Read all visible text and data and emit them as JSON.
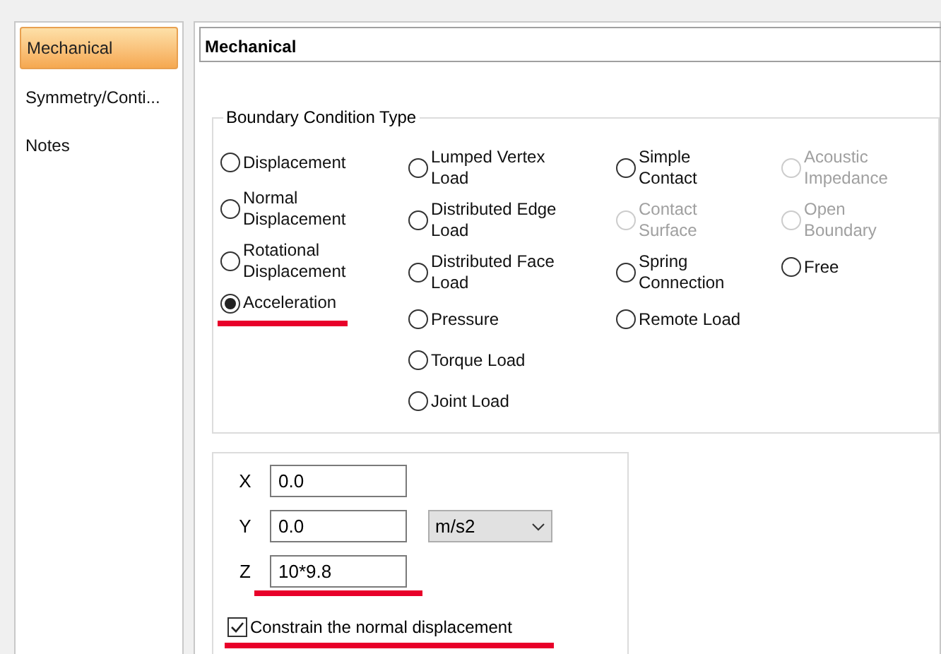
{
  "sidebar": {
    "items": [
      {
        "label": "Mechanical",
        "selected": true
      },
      {
        "label": "Symmetry/Conti...",
        "selected": false
      },
      {
        "label": "Notes",
        "selected": false
      }
    ]
  },
  "panel": {
    "title": "Mechanical"
  },
  "boundary_condition_type": {
    "title": "Boundary Condition Type",
    "columns": [
      [
        {
          "label": "Displacement",
          "selected": false,
          "disabled": false,
          "underlined": false
        },
        {
          "label": "Normal\nDisplacement",
          "selected": false,
          "disabled": false,
          "underlined": false
        },
        {
          "label": "Rotational\nDisplacement",
          "selected": false,
          "disabled": false,
          "underlined": false
        },
        {
          "label": "Acceleration",
          "selected": true,
          "disabled": false,
          "underlined": true
        }
      ],
      [
        {
          "label": "Lumped Vertex\nLoad",
          "selected": false,
          "disabled": false,
          "underlined": false
        },
        {
          "label": "Distributed Edge\nLoad",
          "selected": false,
          "disabled": false,
          "underlined": false
        },
        {
          "label": "Distributed Face\nLoad",
          "selected": false,
          "disabled": false,
          "underlined": false
        },
        {
          "label": "Pressure",
          "selected": false,
          "disabled": false,
          "underlined": false
        },
        {
          "label": "Torque Load",
          "selected": false,
          "disabled": false,
          "underlined": false
        },
        {
          "label": "Joint Load",
          "selected": false,
          "disabled": false,
          "underlined": false
        }
      ],
      [
        {
          "label": "Simple\nContact",
          "selected": false,
          "disabled": false,
          "underlined": false
        },
        {
          "label": "Contact\nSurface",
          "selected": false,
          "disabled": true,
          "underlined": false
        },
        {
          "label": "Spring\nConnection",
          "selected": false,
          "disabled": false,
          "underlined": false
        },
        {
          "label": "Remote Load",
          "selected": false,
          "disabled": false,
          "underlined": false
        }
      ],
      [
        {
          "label": "Acoustic\nImpedance",
          "selected": false,
          "disabled": true,
          "underlined": false
        },
        {
          "label": "Open\nBoundary",
          "selected": false,
          "disabled": true,
          "underlined": false
        },
        {
          "label": "Free",
          "selected": false,
          "disabled": false,
          "underlined": false
        }
      ]
    ]
  },
  "fields": [
    {
      "label": "X",
      "value": "0.0",
      "underlined": false
    },
    {
      "label": "Y",
      "value": "0.0",
      "underlined": false
    },
    {
      "label": "Z",
      "value": "10*9.8",
      "underlined": true
    }
  ],
  "unit": {
    "value": "m/s2"
  },
  "constrain": {
    "label": "Constrain the normal displacement",
    "checked": true,
    "underlined": true
  }
}
